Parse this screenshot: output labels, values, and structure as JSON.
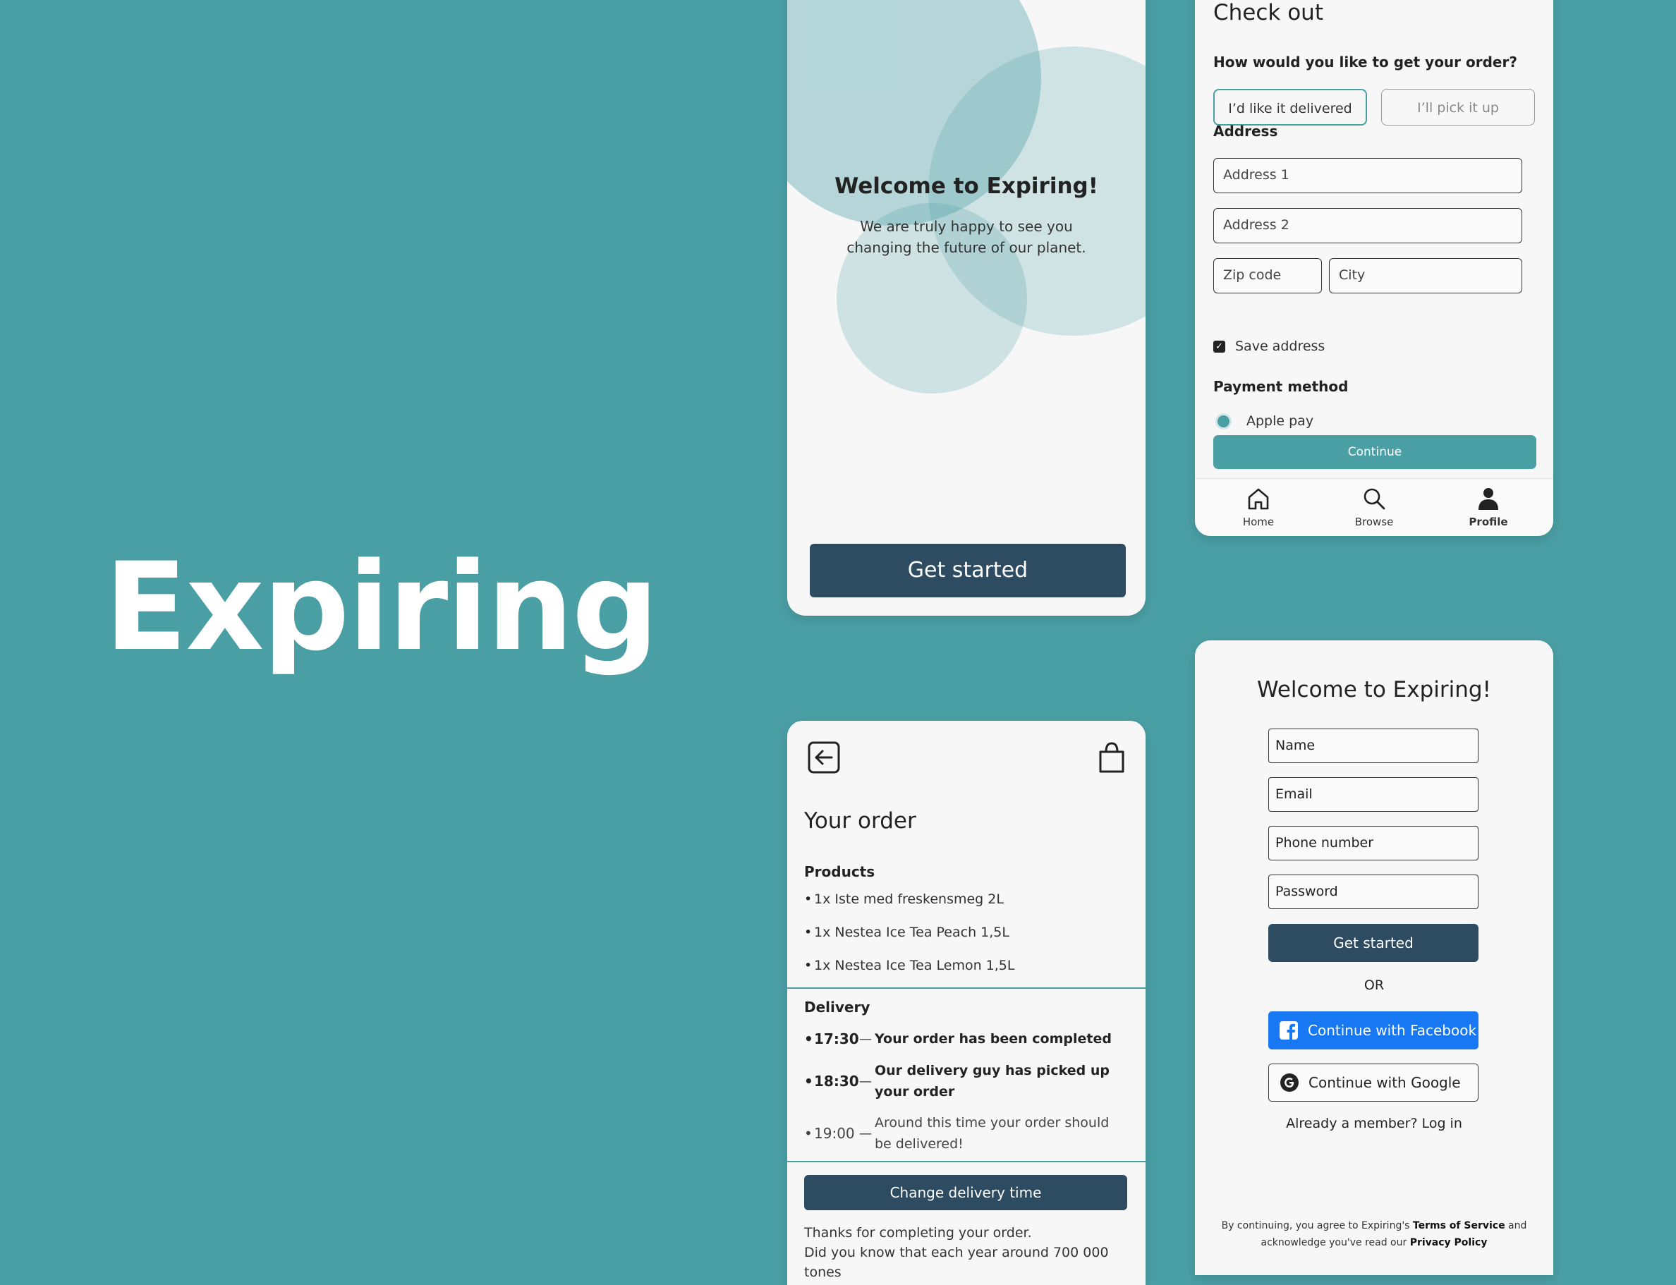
{
  "brand": {
    "title": "Expiring"
  },
  "splash": {
    "title": "Welcome to Expiring!",
    "text": "We are truly happy to see you changing the future of our planet.",
    "button": "Get started"
  },
  "checkout": {
    "title": "Check out",
    "question": "How would you like to get your order?",
    "option_delivery": "I’d like it delivered",
    "option_pickup": "I’ll pick it up",
    "address_label": "Address",
    "address1_placeholder": "Address 1",
    "address2_placeholder": "Address 2",
    "zip_placeholder": "Zip code",
    "city_placeholder": "City",
    "save_address_label": "Save address",
    "save_address_checked": true,
    "payment_label": "Payment method",
    "payment_option": "Apple pay",
    "continue": "Continue",
    "nav": [
      {
        "label": "Home",
        "icon": "home-icon"
      },
      {
        "label": "Browse",
        "icon": "search-icon"
      },
      {
        "label": "Profile",
        "icon": "profile-icon"
      }
    ]
  },
  "order": {
    "title": "Your order",
    "products_label": "Products",
    "products": [
      "1x Iste med freskensmeg 2L",
      "1x Nestea Ice Tea Peach 1,5L",
      "1x Nestea Ice Tea Lemon 1,5L"
    ],
    "delivery_label": "Delivery",
    "delivery": [
      {
        "time": "17:30",
        "text": "Your order has been completed"
      },
      {
        "time": "18:30",
        "text": "Our delivery guy has picked up your order"
      },
      {
        "time": "19:00",
        "text": "Around this time your order  should be delivered!"
      }
    ],
    "button": "Change delivery time",
    "footer_line1": "Thanks for completing your order.",
    "footer_line2": "Did you know that each year around 700 000 tones"
  },
  "signup": {
    "title": "Welcome to Expiring!",
    "name_placeholder": "Name",
    "email_placeholder": "Email",
    "phone_placeholder": "Phone number",
    "password_placeholder": "Password",
    "button": "Get started",
    "or": "OR",
    "facebook": "Continue with Facebook",
    "google": "Continue with Google",
    "login": "Already a member? Log in",
    "legal_prefix": "By continuing, you agree to Expiring's",
    "legal_terms": "Terms of Service",
    "legal_and": "and acknowledge you've read our",
    "legal_privacy": "Privacy Policy"
  },
  "colors": {
    "background": "#4A9FA5",
    "accent": "#4A9FA5",
    "dark_button": "#2D4C61",
    "facebook": "#1877F2"
  }
}
